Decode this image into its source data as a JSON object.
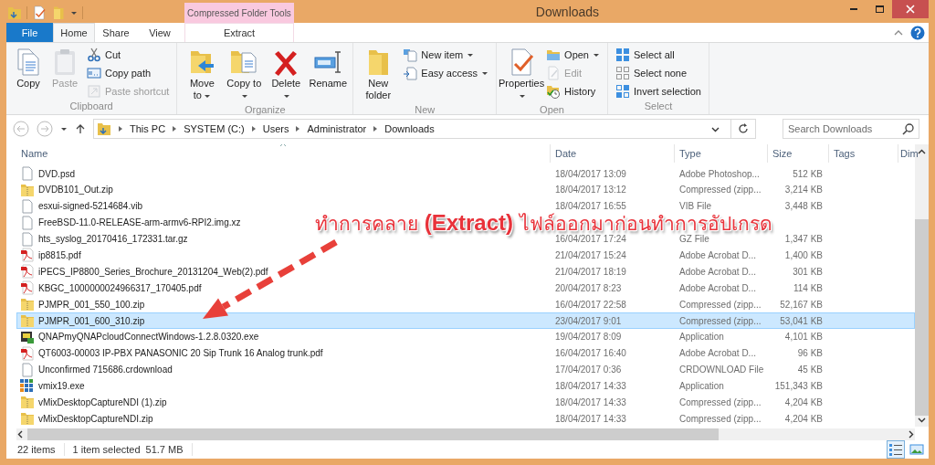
{
  "title_bar": {
    "title": "Downloads",
    "context_group": "Compressed Folder Tools"
  },
  "tabs": [
    {
      "label": "File",
      "kind": "file",
      "selected": false
    },
    {
      "label": "Home",
      "kind": "tab",
      "selected": true
    },
    {
      "label": "Share",
      "kind": "tab",
      "selected": false
    },
    {
      "label": "View",
      "kind": "tab",
      "selected": false
    },
    {
      "label": "Extract",
      "kind": "context",
      "selected": false
    }
  ],
  "ribbon": {
    "groups": [
      {
        "label": "Clipboard",
        "items": [
          {
            "label": "Copy",
            "kind": "large",
            "disabled": false,
            "dropdown": false
          },
          {
            "label": "Paste",
            "kind": "large",
            "disabled": true,
            "dropdown": false
          },
          {
            "label": "Cut",
            "kind": "small",
            "disabled": false,
            "dropdown": false
          },
          {
            "label": "Copy path",
            "kind": "small",
            "disabled": false,
            "dropdown": false
          },
          {
            "label": "Paste shortcut",
            "kind": "small",
            "disabled": true,
            "dropdown": false
          }
        ]
      },
      {
        "label": "Organize",
        "items": [
          {
            "label": "Move to",
            "kind": "large",
            "disabled": false,
            "dropdown": true
          },
          {
            "label": "Copy to",
            "kind": "large",
            "disabled": false,
            "dropdown": true
          },
          {
            "label": "Delete",
            "kind": "large",
            "disabled": false,
            "dropdown": true
          },
          {
            "label": "Rename",
            "kind": "large",
            "disabled": false,
            "dropdown": false
          }
        ]
      },
      {
        "label": "New",
        "items": [
          {
            "label": "New folder",
            "kind": "large",
            "disabled": false,
            "dropdown": false
          },
          {
            "label": "New item",
            "kind": "small",
            "disabled": false,
            "dropdown": true
          },
          {
            "label": "Easy access",
            "kind": "small",
            "disabled": false,
            "dropdown": true
          }
        ]
      },
      {
        "label": "Open",
        "items": [
          {
            "label": "Properties",
            "kind": "large",
            "disabled": false,
            "dropdown": true
          },
          {
            "label": "Open",
            "kind": "small",
            "disabled": false,
            "dropdown": true
          },
          {
            "label": "Edit",
            "kind": "small",
            "disabled": true,
            "dropdown": false
          },
          {
            "label": "History",
            "kind": "small",
            "disabled": false,
            "dropdown": false
          }
        ]
      },
      {
        "label": "Select",
        "items": [
          {
            "label": "Select all",
            "kind": "small",
            "disabled": false,
            "dropdown": false
          },
          {
            "label": "Select none",
            "kind": "small",
            "disabled": false,
            "dropdown": false
          },
          {
            "label": "Invert selection",
            "kind": "small",
            "disabled": false,
            "dropdown": false
          }
        ]
      }
    ]
  },
  "address_bar": {
    "path": [
      "This PC",
      "SYSTEM (C:)",
      "Users",
      "Administrator",
      "Downloads"
    ]
  },
  "search": {
    "placeholder": "Search Downloads"
  },
  "table": {
    "columns": [
      "Name",
      "Date",
      "Type",
      "Size",
      "Tags",
      "Dim"
    ],
    "rows": [
      {
        "name": "DVD.psd",
        "date": "18/04/2017 13:09",
        "type": "Adobe Photoshop...",
        "size": "512 KB",
        "kind": "file",
        "selected": false
      },
      {
        "name": "DVDB101_Out.zip",
        "date": "18/04/2017 13:12",
        "type": "Compressed (zipp...",
        "size": "3,214 KB",
        "kind": "zip",
        "selected": false
      },
      {
        "name": "esxui-signed-5214684.vib",
        "date": "18/04/2017 16:55",
        "type": "VIB File",
        "size": "3,448 KB",
        "kind": "file",
        "selected": false
      },
      {
        "name": "FreeBSD-11.0-RELEASE-arm-armv6-RPI2.img.xz",
        "kind": "file",
        "selected": false
      },
      {
        "name": "hts_syslog_20170416_172331.tar.gz",
        "date": "16/04/2017 17:24",
        "type": "GZ File",
        "size": "1,347 KB",
        "kind": "file",
        "selected": false
      },
      {
        "name": "ip8815.pdf",
        "date": "21/04/2017 15:24",
        "type": "Adobe Acrobat D...",
        "size": "1,400 KB",
        "kind": "pdf",
        "selected": false
      },
      {
        "name": "iPECS_IP8800_Series_Brochure_20131204_Web(2).pdf",
        "date": "21/04/2017 18:19",
        "type": "Adobe Acrobat D...",
        "size": "301 KB",
        "kind": "pdf",
        "selected": false
      },
      {
        "name": "KBGC_1000000024966317_170405.pdf",
        "date": "20/04/2017 8:23",
        "type": "Adobe Acrobat D...",
        "size": "114 KB",
        "kind": "pdf",
        "selected": false
      },
      {
        "name": "PJMPR_001_550_100.zip",
        "date": "16/04/2017 22:58",
        "type": "Compressed (zipp...",
        "size": "52,167 KB",
        "kind": "zip",
        "selected": false
      },
      {
        "name": "PJMPR_001_600_310.zip",
        "date": "23/04/2017 9:01",
        "type": "Compressed (zipp...",
        "size": "53,041 KB",
        "kind": "zip",
        "selected": true
      },
      {
        "name": "QNAPmyQNAPcloudConnectWindows-1.2.8.0320.exe",
        "date": "19/04/2017 8:09",
        "type": "Application",
        "size": "4,101 KB",
        "kind": "app",
        "selected": false
      },
      {
        "name": "QT6003-00003 IP-PBX PANASONIC 20 Sip Trunk 16 Analog trunk.pdf",
        "date": "16/04/2017 16:40",
        "type": "Adobe Acrobat D...",
        "size": "96 KB",
        "kind": "pdf",
        "selected": false
      },
      {
        "name": "Unconfirmed 715686.crdownload",
        "date": "17/04/2017 0:36",
        "type": "CRDOWNLOAD File",
        "size": "45 KB",
        "kind": "file",
        "selected": false
      },
      {
        "name": "vmix19.exe",
        "date": "18/04/2017 14:33",
        "type": "Application",
        "size": "151,343 KB",
        "kind": "grid",
        "selected": false
      },
      {
        "name": "vMixDesktopCaptureNDI (1).zip",
        "date": "18/04/2017 14:33",
        "type": "Compressed (zipp...",
        "size": "4,204 KB",
        "kind": "zip",
        "selected": false
      },
      {
        "name": "vMixDesktopCaptureNDI.zip",
        "date": "18/04/2017 14:33",
        "type": "Compressed (zipp...",
        "size": "4,204 KB",
        "kind": "zip",
        "selected": false
      }
    ]
  },
  "annotation": {
    "text": "ทำการคลาย **(Extract)** ไฟล์ออกมาก่อนทำการอัปเกรด"
  },
  "status_bar": {
    "item_count": "22 items",
    "selection": "1 item selected",
    "selection_size": "51.7 MB"
  },
  "view_buttons": [
    {
      "kind": "details",
      "selected": true
    },
    {
      "kind": "large_icons",
      "selected": false
    }
  ]
}
